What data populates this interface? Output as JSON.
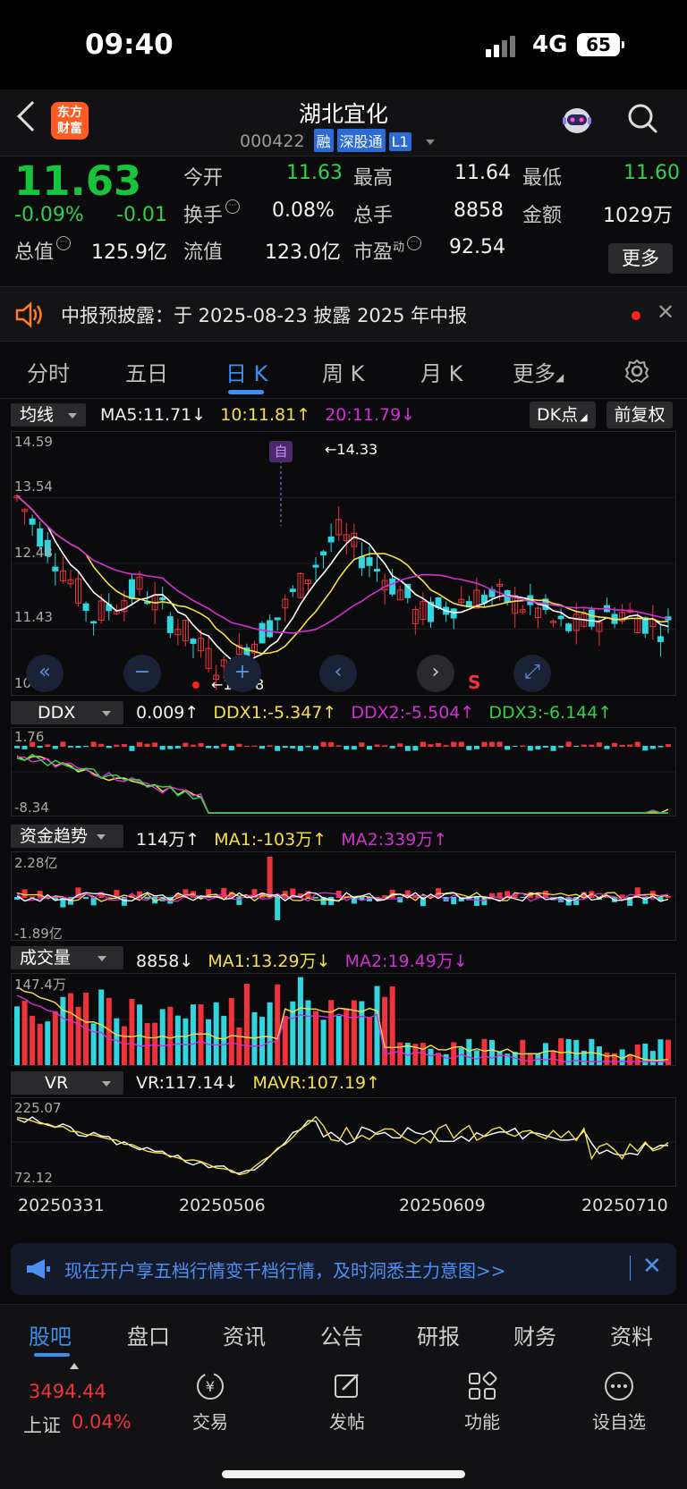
{
  "status_bar": {
    "time": "09:40",
    "network": "4G",
    "battery": "65"
  },
  "header": {
    "title": "湖北宜化",
    "code": "000422",
    "tags": [
      "融",
      "深股通",
      "L1"
    ],
    "logo_text": "东方财富"
  },
  "quote": {
    "price": "11.63",
    "change_pct": "-0.09%",
    "change": "-0.01",
    "fields": {
      "open_label": "今开",
      "open": "11.63",
      "high_label": "最高",
      "high": "11.64",
      "low_label": "最低",
      "low": "11.60",
      "turnover_label": "换手",
      "turnover": "0.08%",
      "volume_label": "总手",
      "volume": "8858",
      "amount_label": "金额",
      "amount": "1029万",
      "mktcap_label": "总值",
      "mktcap": "125.9亿",
      "float_label": "流值",
      "float": "123.0亿",
      "pe_label": "市盈",
      "pe_sup": "动",
      "pe": "92.54"
    },
    "more_label": "更多"
  },
  "notice": {
    "text": "中报预披露：于 2025-08-23 披露 2025 年中报"
  },
  "tabs": [
    "分时",
    "五日",
    "日 K",
    "周 K",
    "月 K",
    "更多"
  ],
  "active_tab": "日 K",
  "ma_row": {
    "selector": "均线",
    "ma5": "MA5:11.71↓",
    "ma10": "10:11.81↑",
    "ma20": "20:11.79↓",
    "dk_label": "DK点",
    "fq_label": "前复权"
  },
  "kline": {
    "axis_labels": [
      "14.59",
      "13.54",
      "12.48",
      "11.43",
      "10.38"
    ],
    "high_marker": "←14.33",
    "low_marker": "←10.38",
    "self_marker": "自",
    "s_marker": "S",
    "colors": {
      "up": "#f0323a",
      "down": "#2fd6e0",
      "ma5": "#ffffff",
      "ma10": "#f5e04a",
      "ma20": "#d330d3"
    }
  },
  "ddx_row": {
    "selector": "DDX",
    "value": "0.009↑",
    "ddx1": "DDX1:-5.347↑",
    "ddx2": "DDX2:-5.504↑",
    "ddx3": "DDX3:-6.144↑",
    "axis_labels": [
      "1.76",
      "-8.34"
    ]
  },
  "fund_row": {
    "selector": "资金趋势",
    "value": "114万↑",
    "ma1": "MA1:-103万↑",
    "ma2": "MA2:339万↑",
    "axis_labels": [
      "2.28亿",
      "-1.89亿"
    ]
  },
  "vol_row": {
    "selector": "成交量",
    "value": "8858↓",
    "ma1": "MA1:13.29万↓",
    "ma2": "MA2:19.49万↓",
    "axis_labels": [
      "147.4万"
    ]
  },
  "vr_row": {
    "selector": "VR",
    "value": "VR:117.14↓",
    "mavr": "MAVR:107.19↑",
    "axis_labels": [
      "225.07",
      "72.12"
    ]
  },
  "dates": [
    "20250331",
    "20250506",
    "20250609",
    "20250710"
  ],
  "promo": {
    "text": "现在开户享五档行情变千档行情，及时洞悉主力意图>>"
  },
  "bottom_tabs": [
    "股吧",
    "盘口",
    "资讯",
    "公告",
    "研报",
    "财务",
    "资料"
  ],
  "active_bottom_tab": "股吧",
  "bottom_nav": {
    "index_value": "3494.44",
    "index_name": "上证",
    "index_change": "0.04%",
    "items": [
      "交易",
      "发帖",
      "功能",
      "设自选"
    ]
  }
}
